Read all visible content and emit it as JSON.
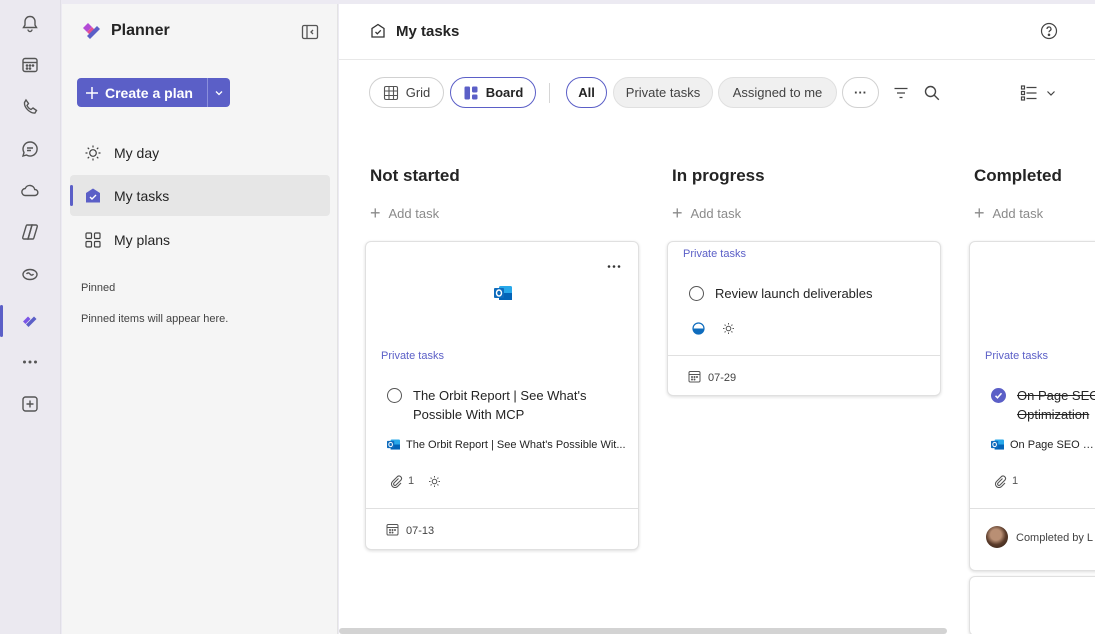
{
  "app": {
    "name": "Planner",
    "accent": "#5b5fc7"
  },
  "rail": {
    "icons": [
      "bell-icon",
      "calendar-icon",
      "phone-icon",
      "chat-icon",
      "cloud-icon",
      "copilot-icon",
      "viva-icon",
      "planner-icon",
      "more-icon",
      "add-app-icon"
    ]
  },
  "sidebar": {
    "create_label": "Create a plan",
    "nav": [
      {
        "label": "My day",
        "icon": "sun-icon"
      },
      {
        "label": "My tasks",
        "icon": "my-tasks-icon",
        "active": true
      },
      {
        "label": "My plans",
        "icon": "grid-icon"
      }
    ],
    "pinned_heading": "Pinned",
    "pinned_empty": "Pinned items will appear here."
  },
  "header": {
    "title": "My tasks"
  },
  "toolbar": {
    "view_grid": "Grid",
    "view_board": "Board",
    "filter_all": "All",
    "filter_private": "Private tasks",
    "filter_assigned": "Assigned to me",
    "more": "···"
  },
  "board": {
    "add_task_label": "Add task",
    "columns": [
      {
        "title": "Not started",
        "cards": [
          {
            "plan": "Private tasks",
            "title": "The Orbit Report | See What's Possible With MCP",
            "attachment": "The Orbit Report | See What's Possible Wit...",
            "attachments_count": "1",
            "due": "07-13"
          }
        ]
      },
      {
        "title": "In progress",
        "cards": [
          {
            "plan": "Private tasks",
            "title": "Review launch deliverables",
            "due": "07-29"
          }
        ]
      },
      {
        "title": "Completed",
        "cards": [
          {
            "plan": "Private tasks",
            "title": "On Page SEO Optimization",
            "attachment": "On Page SEO Che",
            "attachments_count": "1",
            "completed_by": "Completed by L"
          }
        ]
      }
    ]
  }
}
